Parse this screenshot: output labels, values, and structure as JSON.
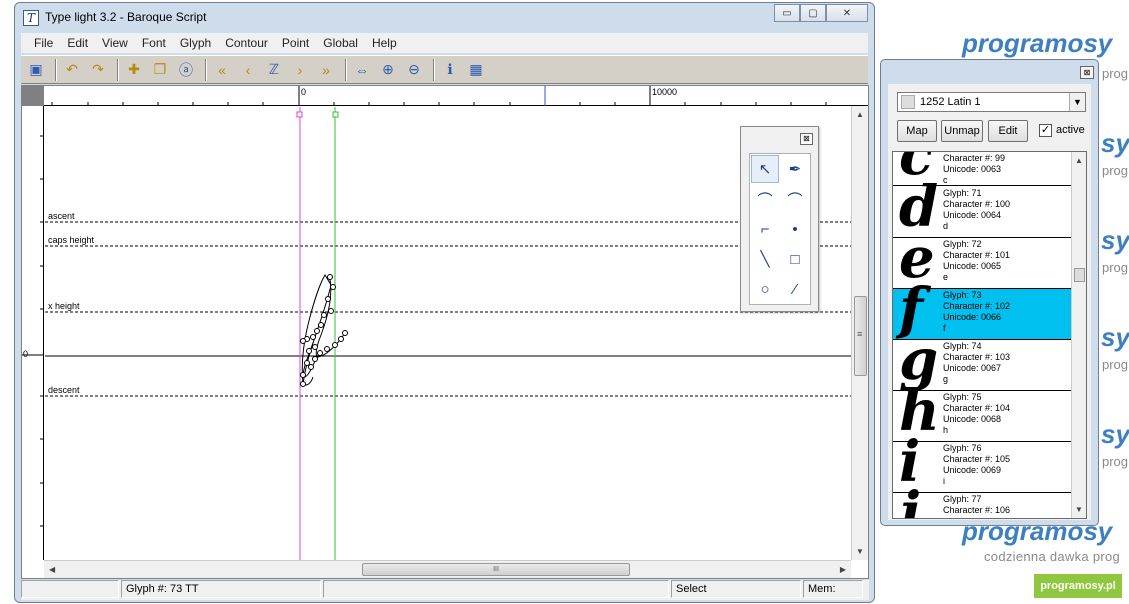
{
  "watermark": {
    "brand": "programosy",
    "brand_partial": "sy",
    "side_text": "prog",
    "tagline": "codzienna dawka prog",
    "badge": "programosy.pl"
  },
  "window": {
    "title": "Type light 3.2  -  Baroque Script",
    "minimize": "▭",
    "maximize": "▢",
    "close": "✕"
  },
  "menu": [
    "File",
    "Edit",
    "View",
    "Font",
    "Glyph",
    "Contour",
    "Point",
    "Global",
    "Help"
  ],
  "toolbar": [
    {
      "icon": "save-icon",
      "glyph": "▣"
    },
    {
      "icon": "undo-icon",
      "glyph": "↶"
    },
    {
      "icon": "redo-icon",
      "glyph": "↷"
    },
    {
      "icon": "new-glyph-icon",
      "glyph": "✚"
    },
    {
      "icon": "copy-glyph-icon",
      "glyph": "❐"
    },
    {
      "icon": "glyph-properties-icon",
      "glyph": "ⓐ"
    },
    {
      "icon": "first-glyph-icon",
      "glyph": "«"
    },
    {
      "icon": "previous-glyph-icon",
      "glyph": "‹"
    },
    {
      "icon": "find-glyph-icon",
      "glyph": "ℤ"
    },
    {
      "icon": "next-glyph-icon",
      "glyph": "›"
    },
    {
      "icon": "last-glyph-icon",
      "glyph": "»"
    },
    {
      "icon": "fit-view-icon",
      "glyph": "⇔"
    },
    {
      "icon": "zoom-in-icon",
      "glyph": "⊕"
    },
    {
      "icon": "zoom-out-icon",
      "glyph": "⊖"
    },
    {
      "icon": "info-icon",
      "glyph": "ℹ"
    },
    {
      "icon": "calculator-icon",
      "glyph": "▦"
    }
  ],
  "ruler": {
    "origin": "0",
    "mark": "10000"
  },
  "vertical_ruler": {
    "origin": "0"
  },
  "metrics": {
    "ascent": "ascent",
    "caps_height": "caps height",
    "x_height": "x height",
    "descent": "descent"
  },
  "hscroll_grip": "III",
  "vscroll_grip": "≡",
  "status": {
    "glyph": "Glyph #: 73   TT",
    "mode": "Select",
    "mem": "Mem:"
  },
  "palette": {
    "close": "⊠",
    "tools": [
      {
        "name": "select-tool-icon",
        "glyph": "↖"
      },
      {
        "name": "pen-tool-icon",
        "glyph": "✒"
      },
      {
        "name": "curve-point-tool-icon",
        "glyph": "⌒"
      },
      {
        "name": "curve-tool-icon",
        "glyph": "⌒"
      },
      {
        "name": "corner-point-tool-icon",
        "glyph": "⌐"
      },
      {
        "name": "tangent-tool-icon",
        "glyph": "•"
      },
      {
        "name": "line-tool-icon",
        "glyph": "╲"
      },
      {
        "name": "rectangle-tool-icon",
        "glyph": "□"
      },
      {
        "name": "ellipse-tool-icon",
        "glyph": "○"
      },
      {
        "name": "measure-tool-icon",
        "glyph": "⁄"
      }
    ]
  },
  "glyph_panel": {
    "close": "⊠",
    "codepage": "1252 Latin 1",
    "map": "Map",
    "unmap": "Unmap",
    "edit": "Edit",
    "active_label": "active",
    "active_checked": "✓",
    "scroll_up": "▲",
    "scroll_down": "▼",
    "glyphs": [
      {
        "char": "c",
        "lines": [
          "Character #: 99",
          "Unicode: 0063",
          "c"
        ]
      },
      {
        "char": "d",
        "lines": [
          "Glyph: 71",
          "Character #: 100",
          "Unicode: 0064",
          "d"
        ]
      },
      {
        "char": "e",
        "lines": [
          "Glyph: 72",
          "Character #: 101",
          "Unicode: 0065",
          "e"
        ]
      },
      {
        "char": "f",
        "lines": [
          "Glyph: 73",
          "Character #: 102",
          "Unicode: 0066",
          "f"
        ],
        "selected": true
      },
      {
        "char": "g",
        "lines": [
          "Glyph: 74",
          "Character #: 103",
          "Unicode: 0067",
          "g"
        ]
      },
      {
        "char": "h",
        "lines": [
          "Glyph: 75",
          "Character #: 104",
          "Unicode: 0068",
          "h"
        ]
      },
      {
        "char": "i",
        "lines": [
          "Glyph: 76",
          "Character #: 105",
          "Unicode: 0069",
          "i"
        ]
      },
      {
        "char": "j",
        "lines": [
          "Glyph: 77",
          "Character #: 106"
        ]
      }
    ]
  },
  "colors": {
    "selection": "#00c0f0",
    "left_guide": "#e040e0",
    "right_guide": "#30c030"
  }
}
